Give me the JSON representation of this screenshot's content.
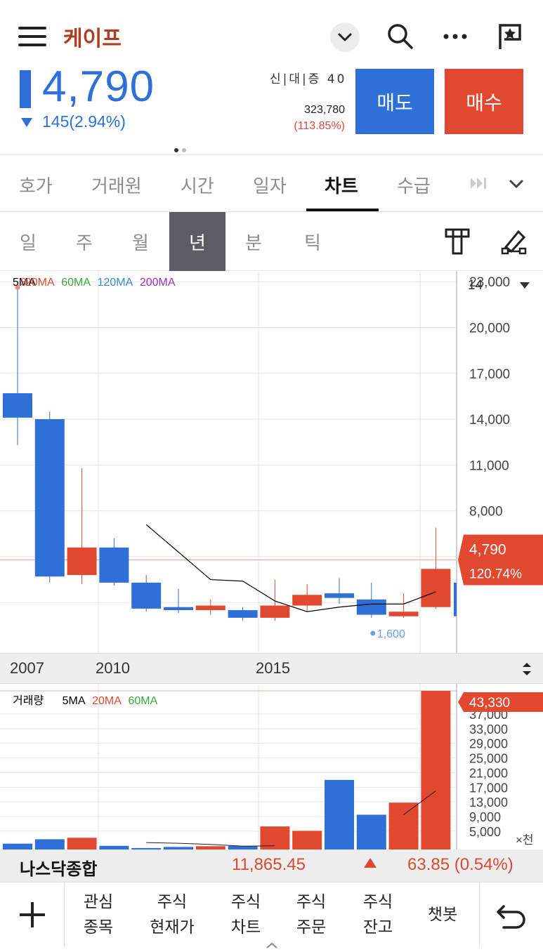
{
  "header": {
    "stock_name": "케이프",
    "price": "4,790",
    "change": "145(2.94%)",
    "credit_label": "신|대|증 40",
    "volume": "323,780",
    "volume_pct": "(113.85%)",
    "sell_label": "매도",
    "buy_label": "매수"
  },
  "tabs": [
    {
      "label": "호가"
    },
    {
      "label": "거래원"
    },
    {
      "label": "시간"
    },
    {
      "label": "일자"
    },
    {
      "label": "차트"
    },
    {
      "label": "수급"
    }
  ],
  "periods": [
    {
      "label": "일"
    },
    {
      "label": "주"
    },
    {
      "label": "월"
    },
    {
      "label": "년"
    },
    {
      "label": "분"
    },
    {
      "label": "틱"
    }
  ],
  "legend": {
    "ma5": "5MA",
    "ma20": "20MA",
    "ma60": "60MA",
    "ma120": "120MA",
    "ma200": "200MA",
    "overlap_text": "3"
  },
  "price_axis": {
    "period_count": "14",
    "ticks": [
      "23,000",
      "20,000",
      "17,000",
      "14,000",
      "11,000",
      "8,000"
    ],
    "current_price": "4,790",
    "current_pct": "120.74%",
    "low_label": "1,600"
  },
  "date_axis": [
    "2007",
    "2010",
    "2015"
  ],
  "volume_panel": {
    "title": "거래량",
    "ma5": "5MA",
    "ma20": "20MA",
    "ma60": "60MA",
    "current": "43,330",
    "ticks": [
      "37,000",
      "33,000",
      "29,000",
      "25,000",
      "21,000",
      "17,000",
      "13,000",
      "9,000",
      "5,000"
    ],
    "unit": "×천"
  },
  "index_bar": {
    "name": "나스닥종합",
    "value": "11,865.45",
    "change": "63.85 (0.54%)"
  },
  "bottom_nav": [
    {
      "line1": "관심",
      "line2": "종목"
    },
    {
      "line1": "주식",
      "line2": "현재가"
    },
    {
      "line1": "주식",
      "line2": "차트"
    },
    {
      "line1": "주식",
      "line2": "주문"
    },
    {
      "line1": "주식",
      "line2": "잔고"
    },
    {
      "line1": "챗봇",
      "line2": ""
    }
  ],
  "colors": {
    "up": "#e2482f",
    "down": "#2f6fd8",
    "ma5": "#000000",
    "ma20": "#e2482f",
    "ma60": "#3aa83a",
    "ma120": "#3a86d1",
    "ma200": "#9b2fc8"
  },
  "chart_data": {
    "type": "candlestick",
    "x": [
      2007,
      2008,
      2009,
      2010,
      2011,
      2012,
      2013,
      2014,
      2015,
      2016,
      2017,
      2018,
      2019,
      2020
    ],
    "candles": [
      {
        "year": 2007,
        "open": 15700,
        "close": 14100,
        "high": 23000,
        "low": 12300,
        "dir": "down"
      },
      {
        "year": 2008,
        "open": 14000,
        "close": 3700,
        "high": 14500,
        "low": 3300,
        "dir": "down"
      },
      {
        "year": 2009,
        "open": 3800,
        "close": 5600,
        "high": 10800,
        "low": 3200,
        "dir": "up"
      },
      {
        "year": 2010,
        "open": 5600,
        "close": 3300,
        "high": 6200,
        "low": 3100,
        "dir": "down"
      },
      {
        "year": 2011,
        "open": 3300,
        "close": 1600,
        "high": 3800,
        "low": 1400,
        "dir": "down"
      },
      {
        "year": 2012,
        "open": 1700,
        "close": 1500,
        "high": 2900,
        "low": 1300,
        "dir": "down"
      },
      {
        "year": 2013,
        "open": 1500,
        "close": 1800,
        "high": 2200,
        "low": 1200,
        "dir": "up"
      },
      {
        "year": 2014,
        "open": 1500,
        "close": 1000,
        "high": 1700,
        "low": 800,
        "dir": "down"
      },
      {
        "year": 2015,
        "open": 1000,
        "close": 1800,
        "high": 3500,
        "low": 800,
        "dir": "up"
      },
      {
        "year": 2016,
        "open": 1800,
        "close": 2500,
        "high": 3200,
        "low": 1400,
        "dir": "up"
      },
      {
        "year": 2017,
        "open": 2600,
        "close": 2300,
        "high": 3600,
        "low": 1900,
        "dir": "down"
      },
      {
        "year": 2018,
        "open": 2200,
        "close": 1200,
        "high": 3300,
        "low": 1000,
        "dir": "down"
      },
      {
        "year": 2019,
        "open": 1100,
        "close": 1400,
        "high": 2600,
        "low": 1000,
        "dir": "up"
      },
      {
        "year": 2020,
        "open": 1700,
        "close": 4200,
        "high": 6900,
        "low": 1600,
        "dir": "up"
      }
    ],
    "ma5": [
      null,
      null,
      null,
      null,
      7100,
      5300,
      3500,
      3400,
      2100,
      1400,
      1700,
      1900,
      1900,
      2700
    ],
    "volume": [
      1600,
      2800,
      3200,
      1000,
      400,
      700,
      900,
      1000,
      6300,
      5100,
      19000,
      9500,
      12800,
      51000
    ],
    "volume_ma5": [
      null,
      null,
      null,
      null,
      1900,
      1700,
      1400,
      900,
      1000,
      null,
      null,
      null,
      null,
      null
    ],
    "ylim": [
      0,
      24000
    ]
  }
}
